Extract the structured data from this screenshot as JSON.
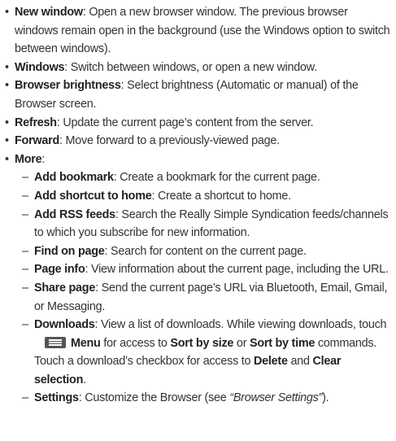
{
  "bullet": "•",
  "dash": "–",
  "items": [
    {
      "term": "New window",
      "desc": ": Open a new browser window. The previous browser windows remain open in the background (use the Windows option to switch between windows)."
    },
    {
      "term": "Windows",
      "desc": ": Switch between windows, or open a new window."
    },
    {
      "term": "Browser brightness",
      "desc": ": Select brightness (Automatic or manual) of the Browser screen."
    },
    {
      "term": "Refresh",
      "desc": ": Update the current page’s content from the server."
    },
    {
      "term": "Forward",
      "desc": ": Move forward to a previously-viewed page."
    },
    {
      "term": "More",
      "desc": ":"
    }
  ],
  "more": [
    {
      "term": "Add bookmark",
      "desc": ": Create a bookmark for the current page."
    },
    {
      "term": "Add shortcut to home",
      "desc": ": Create a shortcut to home."
    },
    {
      "term": "Add RSS feeds",
      "desc": ": Search the Really Simple Syndication feeds/channels to which you subscribe for new information."
    },
    {
      "term": "Find on page",
      "desc": ": Search for content on the current page."
    },
    {
      "term": "Page info",
      "desc": ": View information about the current page, including the URL."
    },
    {
      "term": "Share page",
      "desc": ": Send the current page’s URL via Bluetooth, Email, Gmail, or Messaging."
    }
  ],
  "downloads": {
    "term": "Downloads",
    "desc1": ": View a list of downloads. While viewing downloads, touch",
    "menu": "Menu",
    "t2": " for access to ",
    "sort_size": "Sort by size",
    "t3": " or ",
    "sort_time": "Sort by time",
    "t4": " commands.",
    "line3a": "Touch a download’s checkbox for access to ",
    "delete": "Delete",
    "t5": " and ",
    "clear": "Clear selection",
    "t6": "."
  },
  "settings": {
    "term": "Settings",
    "desc": ": Customize the Browser (see ",
    "link": "“Browser Settings”",
    "end": ")."
  },
  "icons": {
    "menu": "menu-icon"
  }
}
